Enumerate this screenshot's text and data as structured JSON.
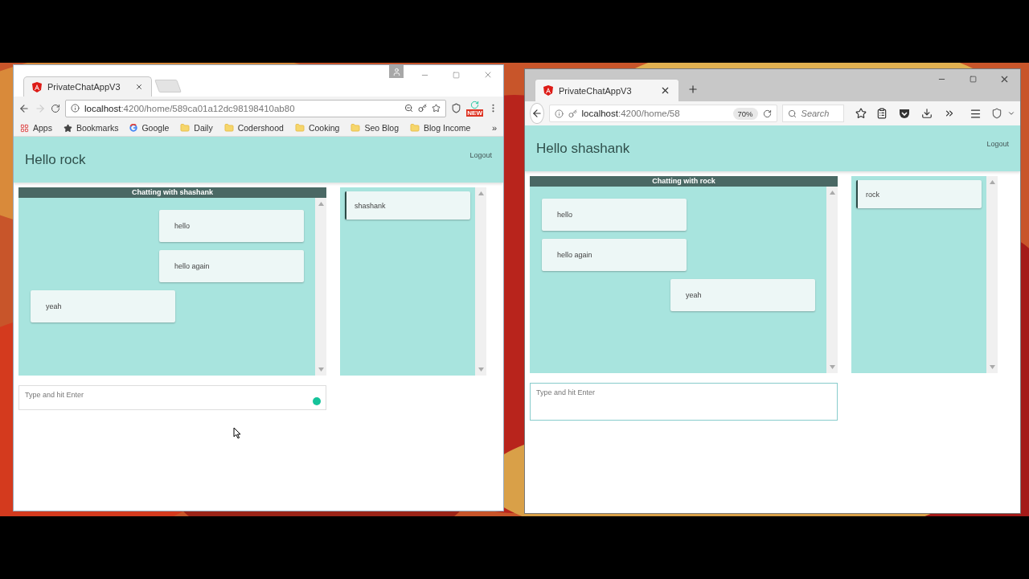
{
  "windows": [
    {
      "kind": "chrome",
      "tab_title": "PrivateChatAppV3",
      "url": {
        "host": "localhost",
        "rest": ":4200/home/589ca01a12dc98198410ab80"
      },
      "extension_badge": "NEW",
      "bookmarks": [
        {
          "kind": "apps",
          "label": "Apps"
        },
        {
          "kind": "star",
          "label": "Bookmarks"
        },
        {
          "kind": "google",
          "label": "Google"
        },
        {
          "kind": "folder",
          "label": "Daily"
        },
        {
          "kind": "folder",
          "label": "Codershood"
        },
        {
          "kind": "folder",
          "label": "Cooking"
        },
        {
          "kind": "folder",
          "label": "Seo Blog"
        },
        {
          "kind": "folder",
          "label": "Blog Income"
        }
      ],
      "bookmarks_more": "»",
      "app": {
        "greeting": "Hello rock",
        "logout": "Logout",
        "chat_title": "Chatting with shashank",
        "messages": [
          {
            "text": "hello",
            "outgoing": true
          },
          {
            "text": "hello again",
            "outgoing": true
          },
          {
            "text": "yeah",
            "outgoing": false
          }
        ],
        "users": [
          {
            "name": "shashank"
          }
        ],
        "input_placeholder": "Type and hit Enter"
      }
    },
    {
      "kind": "firefox",
      "tab_title": "PrivateChatAppV3",
      "url": {
        "host": "localhost",
        "rest": ":4200/home/58"
      },
      "zoom": "70%",
      "search_placeholder": "Search",
      "app": {
        "greeting": "Hello shashank",
        "logout": "Logout",
        "chat_title": "Chatting with rock",
        "messages": [
          {
            "text": "hello",
            "outgoing": false
          },
          {
            "text": "hello again",
            "outgoing": false
          },
          {
            "text": "yeah",
            "outgoing": true
          }
        ],
        "users": [
          {
            "name": "rock"
          }
        ],
        "input_placeholder": "Type and hit Enter"
      }
    }
  ]
}
